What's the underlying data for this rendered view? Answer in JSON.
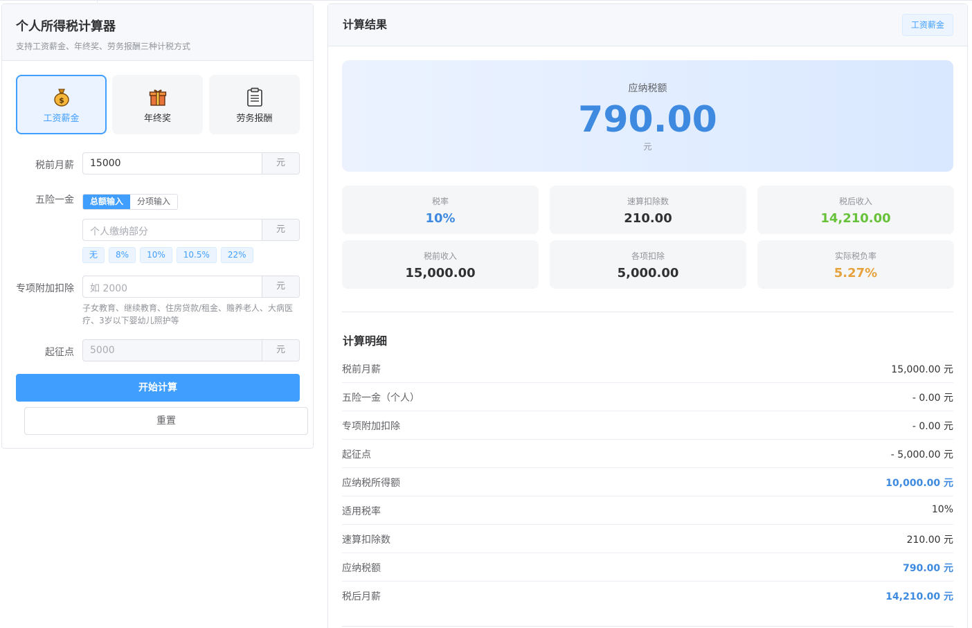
{
  "left": {
    "title": "个人所得税计算器",
    "subtitle": "支持工资薪金、年终奖、劳务报酬三种计税方式",
    "modes": [
      {
        "label": "工资薪金",
        "icon": "money-bag-icon",
        "active": true
      },
      {
        "label": "年终奖",
        "icon": "gift-icon",
        "active": false
      },
      {
        "label": "劳务报酬",
        "icon": "clipboard-icon",
        "active": false
      }
    ],
    "salary": {
      "label": "税前月薪",
      "value": "15000",
      "unit": "元"
    },
    "insurance": {
      "label": "五险一金",
      "modes": [
        "总额输入",
        "分项输入"
      ],
      "placeholder": "个人缴纳部分",
      "unit": "元",
      "quick": [
        "无",
        "8%",
        "10%",
        "10.5%",
        "22%"
      ]
    },
    "special": {
      "label": "专项附加扣除",
      "placeholder": "如 2000",
      "unit": "元",
      "hint": "子女教育、继续教育、住房贷款/租金、赡养老人、大病医疗、3岁以下婴幼儿照护等"
    },
    "threshold": {
      "label": "起征点",
      "value": "5000",
      "unit": "元"
    },
    "calc_button": "开始计算",
    "reset_button": "重置"
  },
  "right": {
    "title": "计算结果",
    "tag": "工资薪金",
    "hero": {
      "label": "应纳税额",
      "value": "790.00",
      "unit": "元"
    },
    "stats": [
      {
        "label": "税率",
        "value": "10%",
        "color": "#3d8ae0"
      },
      {
        "label": "速算扣除数",
        "value": "210.00",
        "color": "#303133"
      },
      {
        "label": "税后收入",
        "value": "14,210.00",
        "color": "#67c23a"
      },
      {
        "label": "税前收入",
        "value": "15,000.00",
        "color": "#303133"
      },
      {
        "label": "各项扣除",
        "value": "5,000.00",
        "color": "#303133"
      },
      {
        "label": "实际税负率",
        "value": "5.27%",
        "color": "#e6a23c"
      }
    ],
    "detail_title": "计算明细",
    "details": [
      {
        "k": "税前月薪",
        "v": "15,000.00 元"
      },
      {
        "k": "五险一金（个人）",
        "v": "- 0.00 元"
      },
      {
        "k": "专项附加扣除",
        "v": "- 0.00 元"
      },
      {
        "k": "起征点",
        "v": "- 5,000.00 元"
      },
      {
        "k": "应纳税所得额",
        "v": "10,000.00 元"
      },
      {
        "k": "适用税率",
        "v": "10%"
      },
      {
        "k": "速算扣除数",
        "v": "210.00 元"
      },
      {
        "k": "应纳税额",
        "v": "790.00 元"
      },
      {
        "k": "税后月薪",
        "v": "14,210.00 元"
      }
    ]
  },
  "colors": {
    "accent": "#409eff",
    "result_blue": "#3d8ae0",
    "green": "#67c23a",
    "orange": "#e6a23c"
  }
}
